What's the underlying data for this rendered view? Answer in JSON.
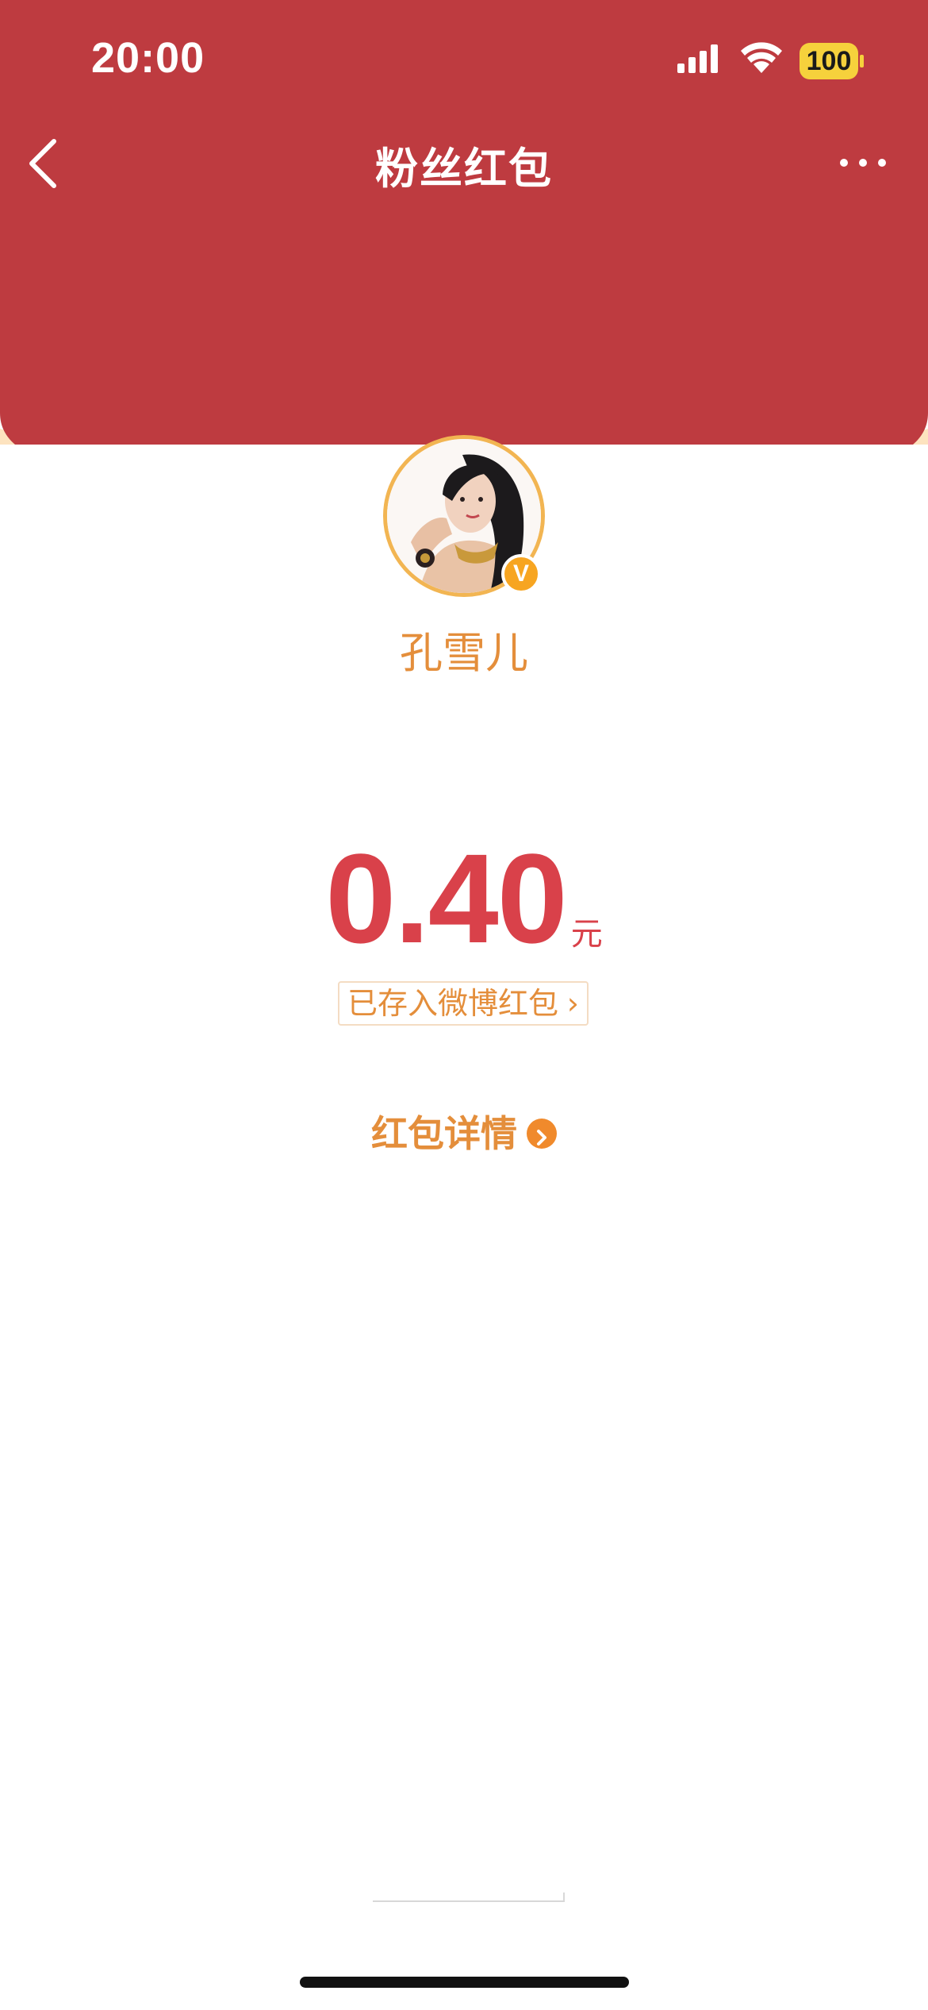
{
  "status_bar": {
    "time": "20:00",
    "battery_level": "100",
    "icons": [
      "signal-icon",
      "wifi-icon",
      "battery-icon"
    ]
  },
  "nav": {
    "title": "粉丝红包",
    "back_icon": "chevron-left-icon",
    "more_icon": "more-horizontal-icon"
  },
  "sender": {
    "name": "孔雪儿",
    "verified_badge": "V"
  },
  "amount": {
    "value": "0.40",
    "unit": "元"
  },
  "saved_link": {
    "label": "已存入微博红包",
    "chevron": "›"
  },
  "details_link": {
    "label": "红包详情"
  },
  "colors": {
    "header_red": "#be3b40",
    "rim_peach": "#fde3bf",
    "accent_orange": "#e48e3b",
    "amount_red": "#d9414a"
  }
}
